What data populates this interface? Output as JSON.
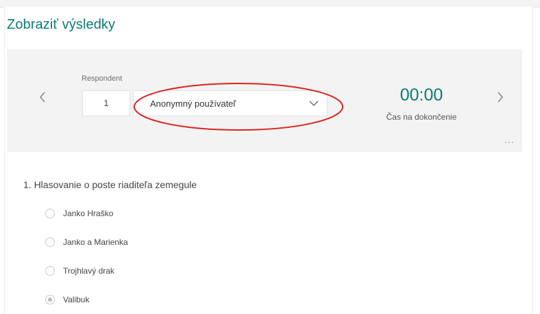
{
  "header": {
    "title": "Zobraziť výsledky"
  },
  "respondent": {
    "label": "Respondent",
    "number": "1",
    "selected_name": "Anonymný používateľ",
    "annotation_color": "#e0201d"
  },
  "completion": {
    "time": "00:00",
    "label": "Čas na dokončenie"
  },
  "navigation": {
    "prev_icon": "chevron-left-icon",
    "next_icon": "chevron-right-icon",
    "more": "..."
  },
  "question": {
    "title": "1. Hlasovanie o poste riaditeľa zemegule",
    "options": [
      {
        "label": "Janko Hraško",
        "selected": false
      },
      {
        "label": "Janko a Marienka",
        "selected": false
      },
      {
        "label": "Trojhlavý drak",
        "selected": false
      },
      {
        "label": "Valibuk",
        "selected": true
      }
    ]
  },
  "colors": {
    "accent": "#0b7a75",
    "bar_background": "#f3f3f3"
  }
}
